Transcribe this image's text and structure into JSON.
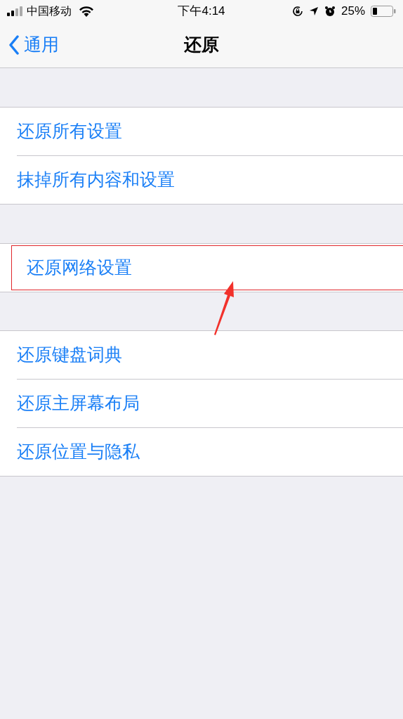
{
  "status_bar": {
    "carrier": "中国移动",
    "time": "下午4:14",
    "battery": "25%"
  },
  "nav": {
    "back": "通用",
    "title": "还原"
  },
  "groups": [
    {
      "items": [
        {
          "label": "还原所有设置",
          "highlighted": false
        },
        {
          "label": "抹掉所有内容和设置",
          "highlighted": false
        }
      ]
    },
    {
      "items": [
        {
          "label": "还原网络设置",
          "highlighted": true
        }
      ]
    },
    {
      "items": [
        {
          "label": "还原键盘词典",
          "highlighted": false
        },
        {
          "label": "还原主屏幕布局",
          "highlighted": false
        },
        {
          "label": "还原位置与隐私",
          "highlighted": false
        }
      ]
    }
  ]
}
